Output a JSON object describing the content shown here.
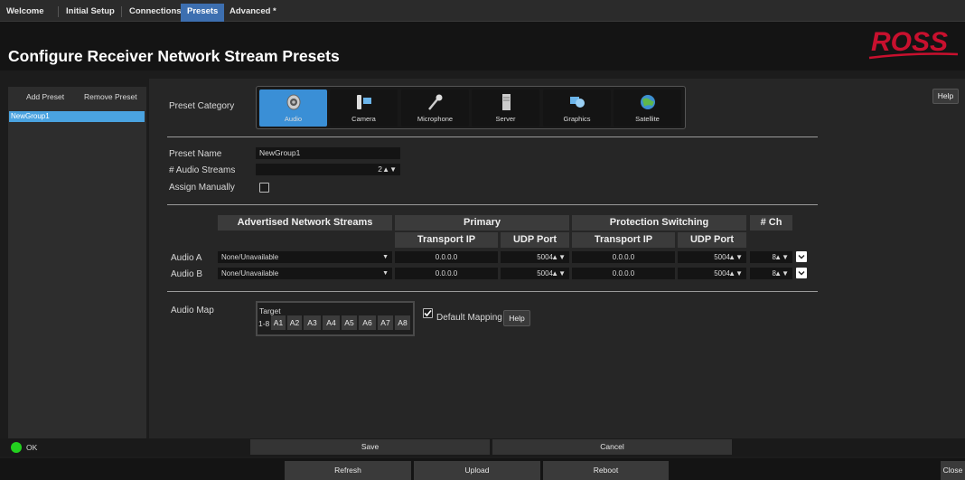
{
  "tabs": [
    {
      "label": "Welcome"
    },
    {
      "label": "Initial Setup"
    },
    {
      "label": "Connections"
    },
    {
      "label": "Presets"
    },
    {
      "label": "Advanced *"
    }
  ],
  "header": {
    "title": "Configure Receiver Network Stream Presets",
    "logo_text": "ROSS",
    "logo_color": "#c8102e"
  },
  "sidebar": {
    "add_label": "Add Preset",
    "remove_label": "Remove Preset",
    "items": [
      {
        "label": "NewGroup1",
        "selected": true
      }
    ]
  },
  "category": {
    "label": "Preset Category",
    "items": [
      {
        "label": "Audio",
        "icon": "speaker-icon",
        "active": true
      },
      {
        "label": "Camera",
        "icon": "camera-icon"
      },
      {
        "label": "Microphone",
        "icon": "microphone-icon"
      },
      {
        "label": "Server",
        "icon": "server-icon"
      },
      {
        "label": "Graphics",
        "icon": "graphics-icon"
      },
      {
        "label": "Satellite",
        "icon": "satellite-icon"
      }
    ]
  },
  "help_label": "Help",
  "form": {
    "preset_name_label": "Preset Name",
    "preset_name_value": "NewGroup1",
    "streams_label": "# Audio Streams",
    "streams_value": "2",
    "assign_label": "Assign Manually",
    "assign_checked": false
  },
  "table": {
    "headers": {
      "advertised": "Advertised Network Streams",
      "primary": "Primary",
      "protection": "Protection Switching",
      "ch": "# Ch",
      "transport_ip": "Transport IP",
      "udp_port": "UDP Port"
    },
    "rows": [
      {
        "label": "Audio A",
        "stream": "None/Unavailable",
        "primary_ip": "0.0.0.0",
        "primary_port": "5004",
        "prot_ip": "0.0.0.0",
        "prot_port": "5004",
        "ch": "8"
      },
      {
        "label": "Audio B",
        "stream": "None/Unavailable",
        "primary_ip": "0.0.0.0",
        "primary_port": "5004",
        "prot_ip": "0.0.0.0",
        "prot_port": "5004",
        "ch": "8"
      }
    ]
  },
  "audio_map": {
    "label": "Audio Map",
    "target_label": "Target",
    "range_label": "1-8",
    "chips": [
      "A1",
      "A2",
      "A3",
      "A4",
      "A5",
      "A6",
      "A7",
      "A8"
    ],
    "default_mapping_label": "Default Mapping",
    "default_mapping_checked": true
  },
  "status": {
    "text": "OK",
    "led_color": "#23d11f",
    "save_label": "Save",
    "cancel_label": "Cancel"
  },
  "bottom": {
    "refresh_label": "Refresh",
    "upload_label": "Upload",
    "reboot_label": "Reboot",
    "close_label": "Close"
  }
}
